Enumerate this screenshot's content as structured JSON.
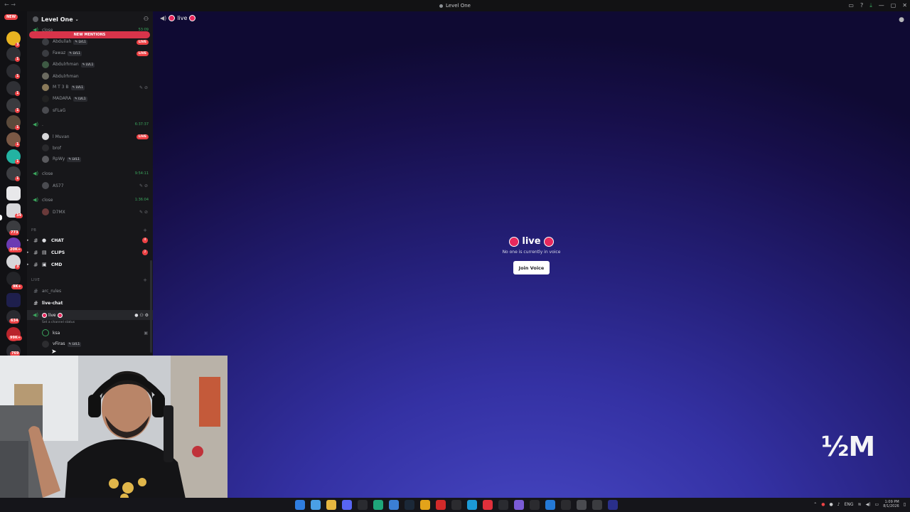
{
  "window": {
    "title": "Level One"
  },
  "server": {
    "name": "Level One",
    "dropdown_icon": "chevron-down-icon"
  },
  "rail": {
    "new_label": "NEW",
    "badges": [
      "3",
      "1",
      "1",
      "1",
      "1",
      "1",
      "1",
      "1",
      "1",
      "1",
      "34",
      "773",
      "20K+",
      "3",
      "9K+",
      "634",
      "99K+",
      "769"
    ]
  },
  "sidebar": {
    "new_mentions_label": "NEW MENTIONS",
    "voice_group_top": {
      "name": "close",
      "time": "53:09",
      "members": [
        {
          "name": "Abdullah",
          "tag": "LVL1",
          "live": true
        },
        {
          "name": "Fawaz",
          "tag": "LVL1",
          "live": true
        },
        {
          "name": "Abdulrhman",
          "tag": "LVL1",
          "live": false
        },
        {
          "name": "Abdulrhman",
          "tag": "",
          "live": false
        },
        {
          "name": "M T 3 B",
          "tag": "LVL1",
          "live": false
        },
        {
          "name": "MADARA",
          "tag": "LVL1",
          "live": false
        },
        {
          "name": "sFLaG",
          "tag": "",
          "live": false
        }
      ]
    },
    "voice_group_2": {
      "name": ".",
      "time": "6:37:37",
      "members": [
        {
          "name": "l Muvan",
          "tag": "",
          "live": true
        },
        {
          "name": "brof",
          "tag": "",
          "live": false
        },
        {
          "name": "RpWy",
          "tag": "LVL1",
          "live": false
        }
      ]
    },
    "voice_group_3": {
      "name": "close",
      "time": "9:54:11",
      "members": [
        {
          "name": "AS77"
        }
      ]
    },
    "voice_group_4": {
      "name": "close",
      "time": "1:36:04",
      "members": [
        {
          "name": "D7MX"
        }
      ]
    },
    "category_pb": "PB",
    "pb_channels": [
      {
        "name": "CHAT",
        "count": "4"
      },
      {
        "name": "CLIPS",
        "count": "2"
      },
      {
        "name": "CMD",
        "count": ""
      }
    ],
    "category_live": "LIVE",
    "live_channels": [
      {
        "name": "arc_rules"
      },
      {
        "name": "live-chat"
      }
    ],
    "live_voice": {
      "name": "live",
      "status_hint": "Set a channel status",
      "members": [
        {
          "name": "ksa"
        },
        {
          "name": "vFiras",
          "tag": "LVL1"
        }
      ]
    },
    "live_badge": "LIVE"
  },
  "main": {
    "channel_name": "live",
    "empty_title": "live",
    "empty_subtitle": "No one is currently in voice",
    "join_button": "Join Voice"
  },
  "overlay": {
    "watermark": "½M"
  },
  "taskbar": {
    "lang": "ENG",
    "time": "1:09 PM",
    "date": "8/1/2026"
  }
}
